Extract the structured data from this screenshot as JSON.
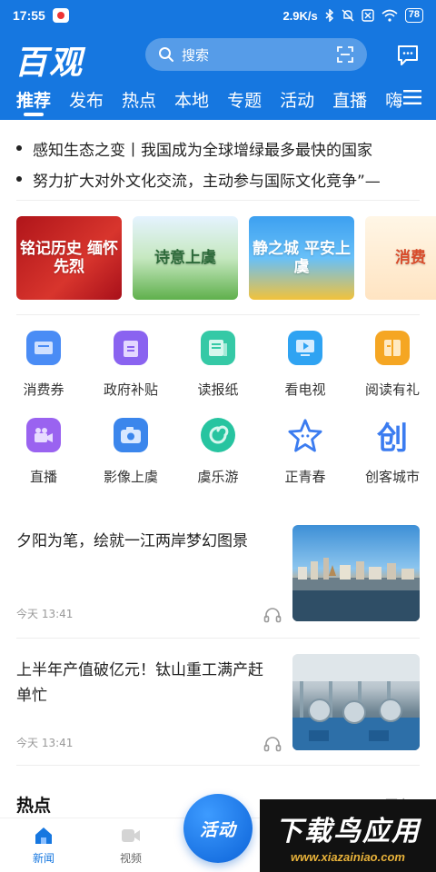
{
  "statusbar": {
    "time": "17:55",
    "net_speed": "2.9K/s",
    "battery": "78"
  },
  "header": {
    "logo": "百观",
    "search_placeholder": "搜索",
    "tabs": [
      "推荐",
      "发布",
      "热点",
      "本地",
      "专题",
      "活动",
      "直播",
      "嗨"
    ]
  },
  "ticker": [
    "感知生态之变丨我国成为全球增绿最多最快的国家",
    "努力扩大对外文化交流，主动参与国际文化竞争”—"
  ],
  "banners": [
    {
      "text": "铭记历史 缅怀先烈"
    },
    {
      "text": "诗意上虞"
    },
    {
      "text": "静之城 平安上虞"
    },
    {
      "text": "消费"
    }
  ],
  "services": [
    {
      "label": "消费券",
      "icon": "ticket-icon",
      "color": "#4a8cf5"
    },
    {
      "label": "政府补贴",
      "icon": "clipboard-icon",
      "color": "#8a63f0"
    },
    {
      "label": "读报纸",
      "icon": "newspaper-icon",
      "color": "#35c9a6"
    },
    {
      "label": "看电视",
      "icon": "tv-play-icon",
      "color": "#2fa3f2"
    },
    {
      "label": "阅读有礼",
      "icon": "book-gift-icon",
      "color": "#f5a623"
    },
    {
      "label": "直播",
      "icon": "camera-live-icon",
      "color": "#9a63f0"
    },
    {
      "label": "影像上虞",
      "icon": "photo-camera-icon",
      "color": "#3b86ec"
    },
    {
      "label": "虞乐游",
      "icon": "swirl-icon",
      "color": "#27c4a0"
    },
    {
      "label": "正青春",
      "icon": "star-face-icon",
      "color": "#3b7cf0"
    },
    {
      "label": "创客城市",
      "icon": "chuang-icon",
      "color": "#3b7cf0"
    }
  ],
  "news": [
    {
      "title": "夕阳为笔，绘就一江两岸梦幻图景",
      "time": "今天 13:41"
    },
    {
      "title": "上半年产值破亿元！钛山重工满产赶单忙",
      "time": "今天 13:41"
    }
  ],
  "section": {
    "hot_title": "热点",
    "more": "更多"
  },
  "bottom_nav": [
    {
      "label": "新闻"
    },
    {
      "label": "视频"
    }
  ],
  "fab_label": "活动",
  "watermark": {
    "main": "下载鸟应用",
    "sub": "www.xiazainiao.com"
  },
  "colors": {
    "brand": "#1677e0"
  }
}
